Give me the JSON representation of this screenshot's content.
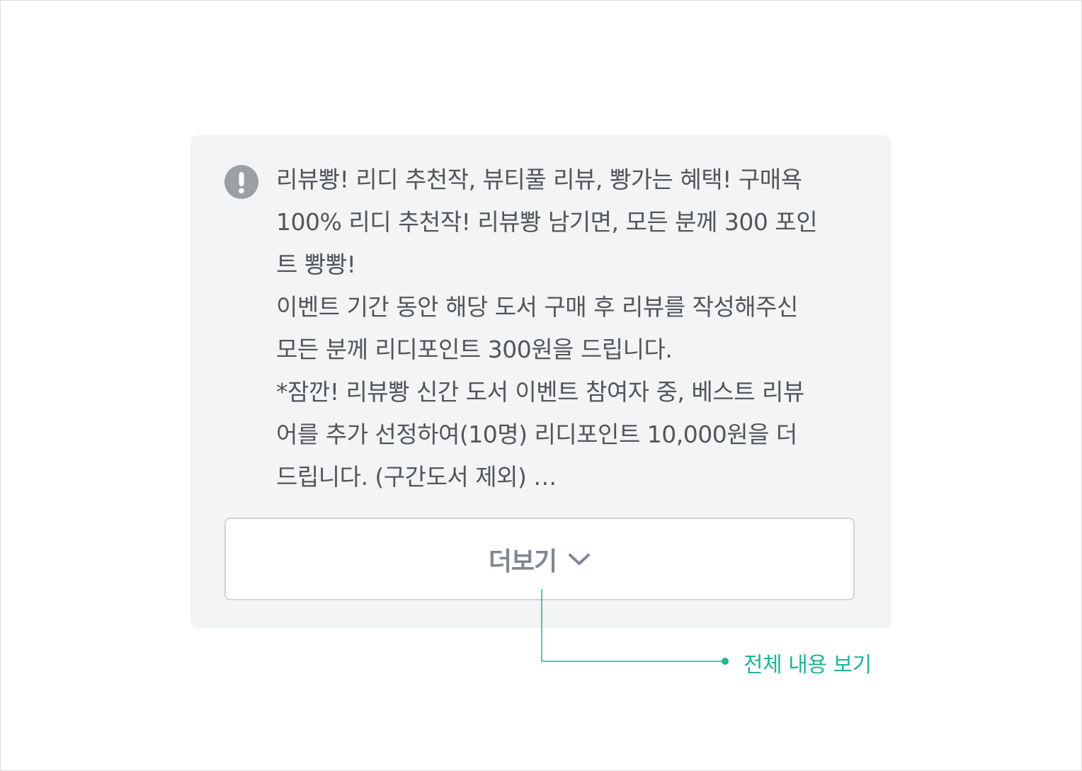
{
  "notice": {
    "icon": "exclamation-circle-icon",
    "lines": [
      "리뷰뽱! 리디 추천작, 뷰티풀 리뷰, 뽱가는 혜택! 구매욕",
      "100% 리디 추천작! 리뷰뽱 남기면, 모든 분께 300 포인",
      "트 뽱뽱!",
      "이벤트 기간 동안 해당 도서 구매 후 리뷰를 작성해주신",
      "모든 분께 리디포인트 300원을 드립니다.",
      "*잠깐! 리뷰뽱 신간 도서 이벤트 참여자 중, 베스트 리뷰",
      "어를 추가 선정하여(10명) 리디포인트 10,000원을 더",
      "드립니다. (구간도서 제외) …"
    ]
  },
  "more_button": {
    "label": "더보기",
    "icon": "chevron-down-icon"
  },
  "annotation": {
    "label": "전체 내용 보기",
    "color": "#1fb59a"
  },
  "colors": {
    "card_background": "#f2f4f5",
    "text": "#52565c",
    "icon": "#9aa0a6",
    "button_border": "#d1d5d9",
    "button_text": "#808991"
  }
}
